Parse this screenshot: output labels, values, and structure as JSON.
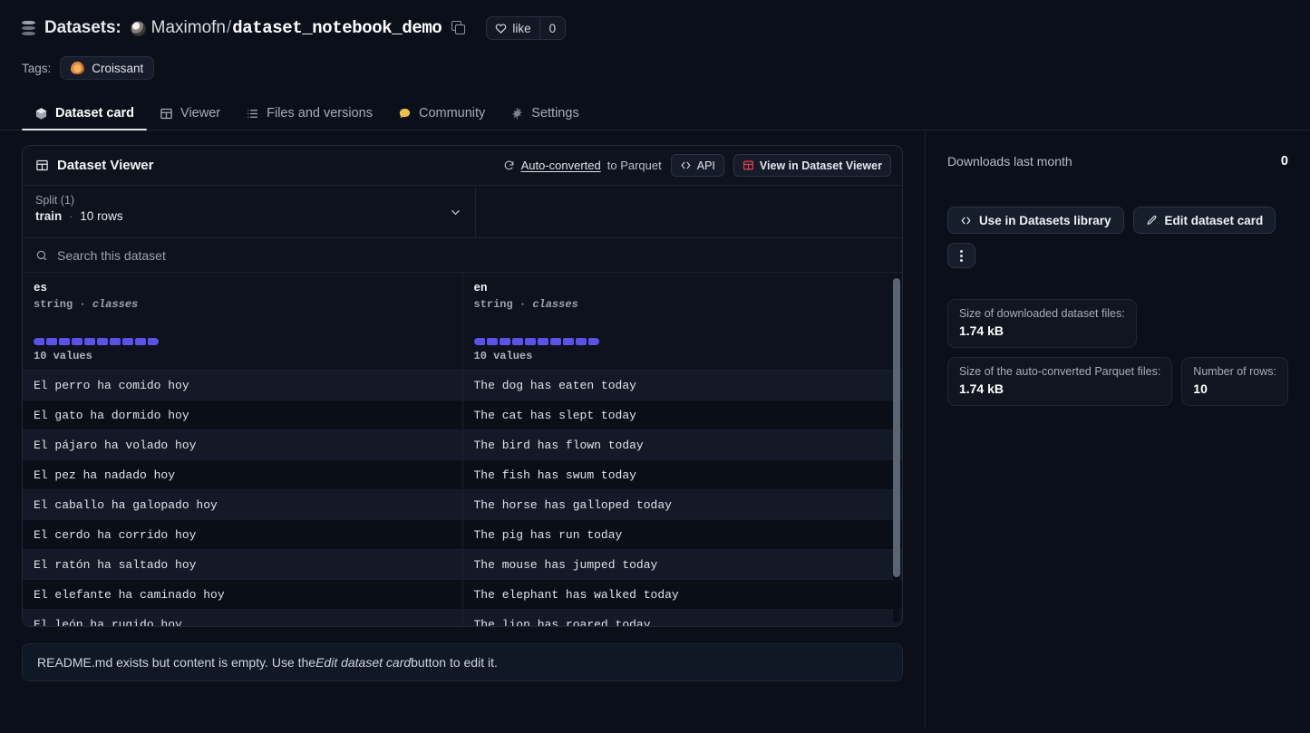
{
  "header": {
    "datasets_label": "Datasets:",
    "owner": "Maximofn",
    "separator": "/",
    "repo_name": "dataset_notebook_demo",
    "like_label": "like",
    "like_count": "0",
    "tags_label": "Tags:",
    "tags": [
      {
        "label": "Croissant",
        "icon": "croissant-icon"
      }
    ]
  },
  "tabs": [
    {
      "label": "Dataset card",
      "icon": "box-icon",
      "active": true
    },
    {
      "label": "Viewer",
      "icon": "table-icon",
      "active": false
    },
    {
      "label": "Files and versions",
      "icon": "files-icon",
      "active": false
    },
    {
      "label": "Community",
      "icon": "comment-icon",
      "active": false
    },
    {
      "label": "Settings",
      "icon": "gear-icon",
      "active": false
    }
  ],
  "viewer": {
    "title": "Dataset Viewer",
    "autoconverted_prefix": "Auto-converted",
    "autoconverted_suffix": "to Parquet",
    "api_label": "API",
    "view_in_viewer_label": "View in Dataset Viewer",
    "split_label": "Split (1)",
    "split_name": "train",
    "split_rows": "10 rows",
    "search_placeholder": "Search this dataset",
    "columns": [
      {
        "name": "es",
        "type": "string · classes",
        "type_plain": "string",
        "type_italic": "classes",
        "values_count": "10 values",
        "distribution_blocks": 10
      },
      {
        "name": "en",
        "type": "string · classes",
        "type_plain": "string",
        "type_italic": "classes",
        "values_count": "10 values",
        "distribution_blocks": 10
      }
    ],
    "rows": [
      {
        "es": "El perro ha comido hoy",
        "en": "The dog has eaten today"
      },
      {
        "es": "El gato ha dormido hoy",
        "en": "The cat has slept today"
      },
      {
        "es": "El pájaro ha volado hoy",
        "en": "The bird has flown today"
      },
      {
        "es": "El pez ha nadado hoy",
        "en": "The fish has swum today"
      },
      {
        "es": "El caballo ha galopado hoy",
        "en": "The horse has galloped today"
      },
      {
        "es": "El cerdo ha corrido hoy",
        "en": "The pig has run today"
      },
      {
        "es": "El ratón ha saltado hoy",
        "en": "The mouse has jumped today"
      },
      {
        "es": "El elefante ha caminado hoy",
        "en": "The elephant has walked today"
      },
      {
        "es": "El león ha rugido hoy",
        "en": "The lion has roared today"
      }
    ]
  },
  "readme_note": {
    "before": "README.md exists but content is empty. Use the ",
    "italic": "Edit dataset card",
    "after": " button to edit it."
  },
  "sidebar": {
    "downloads_label": "Downloads last month",
    "downloads_value": "0",
    "use_in_library_label": "Use in Datasets library",
    "edit_card_label": "Edit dataset card",
    "stats": [
      {
        "label": "Size of downloaded dataset files:",
        "value": "1.74 kB"
      },
      {
        "label": "Size of the auto-converted Parquet files:",
        "value": "1.74 kB"
      },
      {
        "label": "Number of rows:",
        "value": "10"
      }
    ]
  },
  "colors": {
    "page_bg": "#0b0f19",
    "accent_purple": "#5b52e8",
    "viewer_red": "#e23b4e",
    "croissant_orange": "#e08a3c"
  }
}
